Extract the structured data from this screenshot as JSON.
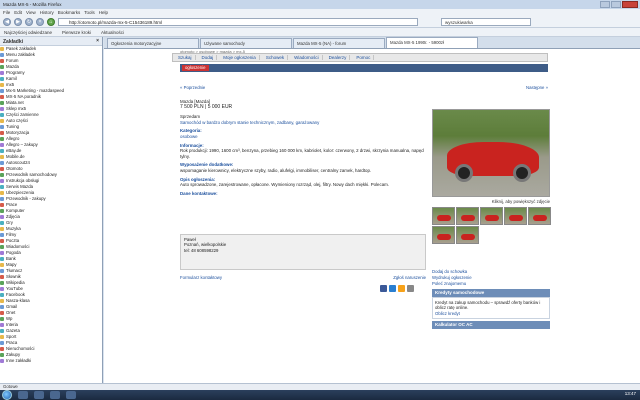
{
  "window": {
    "title": "Mazda MX-5 - Mozilla Firefox"
  },
  "menu": [
    "File",
    "Edit",
    "View",
    "History",
    "Bookmarks",
    "Tools",
    "Help"
  ],
  "nav": {
    "url": "http://otomoto.pl/mazda-mx-5-C15436189.html",
    "search_placeholder": "wyszukiwarka"
  },
  "bookmarks": [
    "Najczęściej odwiedzane",
    "Pierwsze kroki",
    "Aktualności"
  ],
  "sidebar": {
    "title": "Zakładki",
    "items": [
      "Pasek zakładek",
      "Menu zakładek",
      "Forum",
      "Mazda",
      "Programy",
      "Kamil",
      "mx5",
      "Mx-5 Marketing - mazdaspeed",
      "MX-5 NA poradnik",
      "Miata.net",
      "Sklep mx5",
      "Części zamienne",
      "Auto części",
      "Tuning",
      "Motoryzacja",
      "Allegro",
      "Allegro – zakupy",
      "eBay.de",
      "Mobile.de",
      "Autoscout24",
      "Otomoto",
      "Przewodnik samochodowy",
      "Instrukcja obsługi",
      "Serwis Mazda",
      "Ubezpieczenia",
      "Przewodnik - zakupy",
      "Prace",
      "Komputer",
      "Zdjęcia",
      "Gry",
      "Muzyka",
      "Filmy",
      "Poczta",
      "Wiadomości",
      "Pogoda",
      "Bank",
      "Mapy",
      "Tłumacz",
      "Słownik",
      "Wikipedia",
      "YouTube",
      "Facebook",
      "Nasza-klasa",
      "Gmail",
      "Onet",
      "Wp",
      "Interia",
      "Gazeta",
      "Sport",
      "Praca",
      "Nieruchomości",
      "Zakupy",
      "Inne zakładki"
    ]
  },
  "tabs": [
    "Ogłoszenia motoryzacyjne",
    "Używane samochody",
    "Mazda MX-5 (NA) - forum",
    "Mazda MX-5 1990r. - 5900zł"
  ],
  "site": {
    "breadcrumb": "otomoto > osobowe > mazda > mx-5",
    "nav": [
      "Szukaj",
      "Dodaj",
      "Moje ogłoszenia",
      "Schowek",
      "Wiadomości",
      "Dealerzy",
      "Pomoc"
    ],
    "highlight": "ogłoszenie",
    "prev": "« Poprzednie",
    "next": "Następne »"
  },
  "listing": {
    "make_line": "Mazda [Mazda]",
    "price": "7 500 PLN | 5 000 EUR",
    "status": "Sprzedam",
    "desc_link": "Samochód w bardzo dobrym stanie technicznym, zadbany, garażowany",
    "equip_label": "Kategoria:",
    "equip_value": "osobowe",
    "info_label": "Informacje:",
    "info_text": "Rok produkcji: 1990, 1600 cm³, benzyna, przebieg 160 000 km, kabriolet, kolor: czerwony, 2 drzwi, skrzynia manualna, napęd tylny.",
    "extra_label": "Wyposażenie dodatkowe:",
    "extra_text": "wspomaganie kierownicy, elektryczne szyby, radio, alufelgi, immobiliser, centralny zamek, hardtop.",
    "detail_label": "Opis ogłoszenia:",
    "detail_text": "Auto sprowadzone, zarejestrowane, opłacone. Wymieniony rozrząd, olej, filtry. Nowy dach miękki. Polecam.",
    "contact_label": "Dane kontaktowe:",
    "contact_name": "Paweł",
    "contact_loc": "Poznań, wielkopolskie",
    "contact_phone": "tel: 48 608598229",
    "form_link": "Formularz kontaktowy",
    "report_link": "Zgłoś naruszenie"
  },
  "photo": {
    "caption": "Kliknij, aby powiększyć zdjęcie"
  },
  "right": {
    "links": [
      "Dodaj do schowka",
      "Wydrukuj ogłoszenie",
      "Poleć znajomemu"
    ],
    "box1_title": "Kredyty samochodowe",
    "box1_text": "Kredyt na zakup samochodu – sprawdź oferty banków i oblicz ratę online.",
    "box1_link": "Oblicz kredyt",
    "box2_title": "Kalkulator OC AC"
  },
  "status": "Gotowe",
  "clock": "13:47"
}
